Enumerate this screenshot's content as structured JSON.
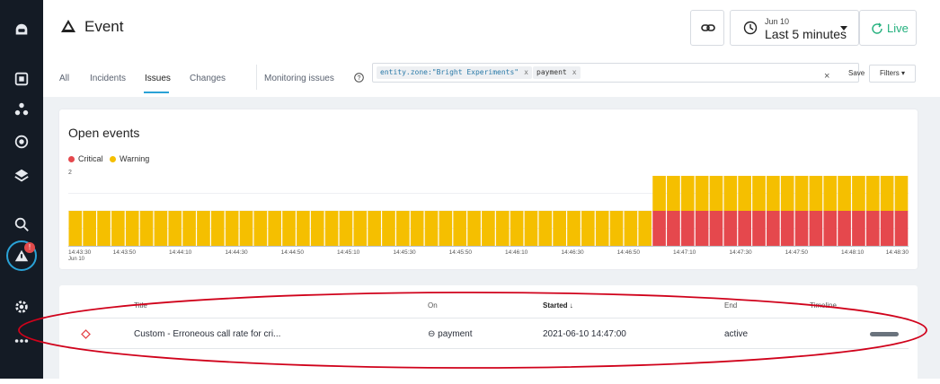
{
  "header": {
    "title": "Event",
    "time_date": "Jun 10",
    "time_range": "Last 5 minutes",
    "live_label": "Live"
  },
  "tabs": [
    {
      "label": "All"
    },
    {
      "label": "Incidents"
    },
    {
      "label": "Issues",
      "active": true
    },
    {
      "label": "Changes"
    },
    {
      "label": "Monitoring issues"
    }
  ],
  "filter": {
    "chips": [
      {
        "text": "entity.zone:\"Bright Experiments\"",
        "remove": "x"
      },
      {
        "text": "payment",
        "remove": "x"
      }
    ],
    "clear": "×",
    "save": "Save",
    "filters": "Filters ▾"
  },
  "chart": {
    "title": "Open events",
    "legend": [
      {
        "label": "Critical",
        "color": "#e5484d"
      },
      {
        "label": "Warning",
        "color": "#f5bf00"
      }
    ],
    "y_tick": "2"
  },
  "chart_data": {
    "type": "bar",
    "stacked": true,
    "ylim": [
      0,
      2
    ],
    "x_tick_labels": [
      "14:43:30",
      "14:43:50",
      "14:44:10",
      "14:44:30",
      "14:44:50",
      "14:45:10",
      "14:45:30",
      "14:45:50",
      "14:46:10",
      "14:46:30",
      "14:46:50",
      "14:47:10",
      "14:47:30",
      "14:47:50",
      "14:48:10",
      "14:48:30"
    ],
    "x_sub_label": "Jun 10",
    "bucket_seconds": 5,
    "series": [
      {
        "name": "Critical",
        "color": "#e5484d",
        "values": [
          0,
          0,
          0,
          0,
          0,
          0,
          0,
          0,
          0,
          0,
          0,
          0,
          0,
          0,
          0,
          0,
          0,
          0,
          0,
          0,
          0,
          0,
          0,
          0,
          0,
          0,
          0,
          0,
          0,
          0,
          0,
          0,
          0,
          0,
          0,
          0,
          0,
          0,
          0,
          0,
          0,
          1,
          1,
          1,
          1,
          1,
          1,
          1,
          1,
          1,
          1,
          1,
          1,
          1,
          1,
          1,
          1,
          1,
          1
        ]
      },
      {
        "name": "Warning",
        "color": "#f5bf00",
        "values": [
          1,
          1,
          1,
          1,
          1,
          1,
          1,
          1,
          1,
          1,
          1,
          1,
          1,
          1,
          1,
          1,
          1,
          1,
          1,
          1,
          1,
          1,
          1,
          1,
          1,
          1,
          1,
          1,
          1,
          1,
          1,
          1,
          1,
          1,
          1,
          1,
          1,
          1,
          1,
          1,
          1,
          1,
          1,
          1,
          1,
          1,
          1,
          1,
          1,
          1,
          1,
          1,
          1,
          1,
          1,
          1,
          1,
          1,
          1
        ]
      }
    ]
  },
  "table": {
    "columns": {
      "title": "Title",
      "on": "On",
      "started": "Started ↓",
      "end": "End",
      "timeline": "Timeline"
    },
    "rows": [
      {
        "title": "Custom - Erroneous call rate for cri...",
        "on": "⊖ payment",
        "started": "2021-06-10 14:47:00",
        "end": "active"
      }
    ]
  },
  "sidebar": {
    "badge": "!"
  },
  "colors": {
    "accent": "#2aa2d6",
    "live": "#22b07d",
    "annotation": "#d0021b"
  }
}
